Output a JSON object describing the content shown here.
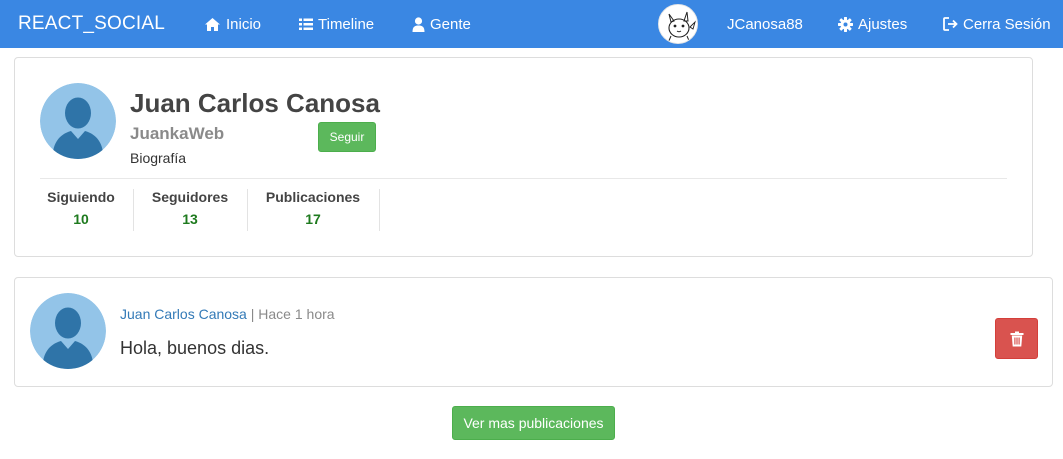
{
  "navbar": {
    "brand": "REACT_SOCIAL",
    "items": [
      {
        "label": "Inicio",
        "icon": "home-icon"
      },
      {
        "label": "Timeline",
        "icon": "list-icon"
      },
      {
        "label": "Gente",
        "icon": "user-icon"
      }
    ],
    "username": "JCanosa88",
    "ajustes": {
      "label": "Ajustes",
      "icon": "gear-icon"
    },
    "logout": {
      "label": "Cerra Sesión",
      "icon": "sign-out-icon"
    },
    "avatar_icon": "pikachu-avatar-icon",
    "color": "#3a87e3"
  },
  "profile": {
    "name": "Juan Carlos Canosa",
    "nick": "JuankaWeb",
    "bio": "Biografía",
    "follow_label": "Seguir",
    "stats": [
      {
        "label": "Siguiendo",
        "value": "10"
      },
      {
        "label": "Seguidores",
        "value": "13"
      },
      {
        "label": "Publicaciones",
        "value": "17"
      }
    ]
  },
  "publication": {
    "author": "Juan Carlos Canosa",
    "separator": " | ",
    "time": "Hace 1 hora",
    "text": "Hola, buenos dias.",
    "delete_icon": "trash-icon"
  },
  "more_label": "Ver mas publicaciones",
  "colors": {
    "success": "#5cb85c",
    "danger": "#d9534f",
    "link": "#337ab7",
    "stat_value": "#1e7a1e"
  }
}
